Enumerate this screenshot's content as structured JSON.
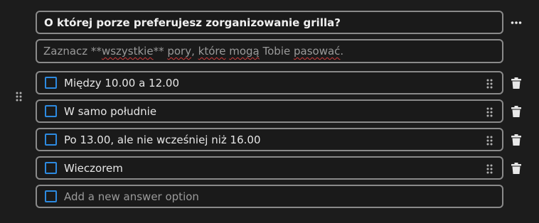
{
  "question": {
    "title": "O której porze preferujesz zorganizowanie grilla?",
    "description_parts": [
      "Zaznacz **",
      "wszystkie",
      "** ",
      "pory",
      ", ",
      "które",
      " ",
      "mogą",
      " Tobie ",
      "pasować",
      "."
    ]
  },
  "options": [
    {
      "label": "Między 10.00 a 12.00"
    },
    {
      "label": "W samo południe"
    },
    {
      "label": "Po 13.00, ale nie wcześniej niż 16.00"
    },
    {
      "label": "Wieczorem"
    }
  ],
  "new_option": {
    "placeholder": "Add a new answer option"
  },
  "icons": {
    "more": "more-horizontal-icon",
    "delete": "trash-icon",
    "drag": "drag-handle-icon"
  },
  "colors": {
    "background": "#1c1c1c",
    "border": "#8a8a8a",
    "checkbox": "#2d8ae0",
    "spellcheck": "#d03a3a"
  }
}
